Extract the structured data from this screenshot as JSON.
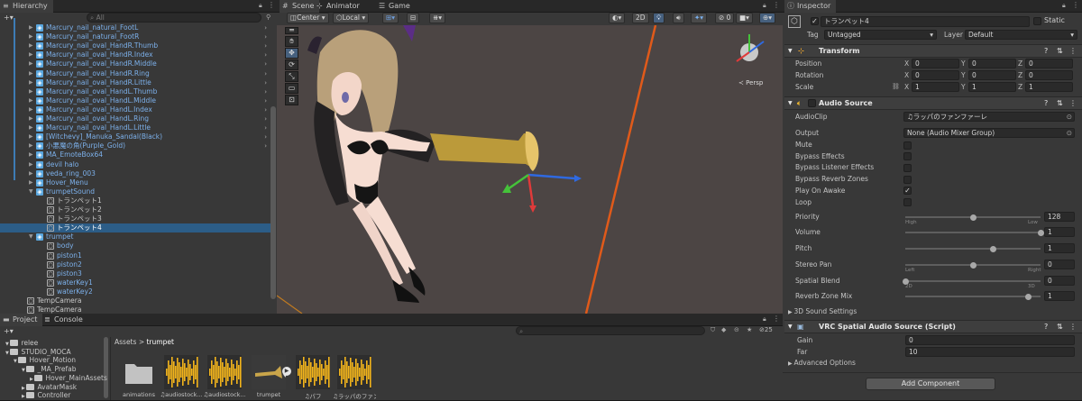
{
  "hierarchy": {
    "tab": "Hierarchy",
    "search_placeholder": "All",
    "rows": [
      {
        "label": "Marcury_nail_natural_FootL",
        "indent": 1
      },
      {
        "label": "Marcury_nail_natural_FootR",
        "indent": 1
      },
      {
        "label": "Marcury_nail_oval_HandR.Thumb",
        "indent": 1
      },
      {
        "label": "Marcury_nail_oval_HandR.Index",
        "indent": 1
      },
      {
        "label": "Marcury_nail_oval_HandR.Middle",
        "indent": 1
      },
      {
        "label": "Marcury_nail_oval_HandR.Ring",
        "indent": 1
      },
      {
        "label": "Marcury_nail_oval_HandR.Little",
        "indent": 1
      },
      {
        "label": "Marcury_nail_oval_HandL.Thumb",
        "indent": 1
      },
      {
        "label": "Marcury_nail_oval_HandL.Middle",
        "indent": 1
      },
      {
        "label": "Marcury_nail_oval_HandL.Index",
        "indent": 1
      },
      {
        "label": "Marcury_nail_oval_HandL.Ring",
        "indent": 1
      },
      {
        "label": "Marcury_nail_oval_HandL.Little",
        "indent": 1
      },
      {
        "label": "[Witchevy]_Manuka_Sandal(Black)",
        "indent": 1
      },
      {
        "label": "小悪魔の角(Purple_Gold)",
        "indent": 1
      },
      {
        "label": "MA_EmoteBox64",
        "indent": 1
      },
      {
        "label": "devil halo",
        "indent": 1
      },
      {
        "label": "veda_ring_003",
        "indent": 1
      },
      {
        "label": "Hover_Menu",
        "indent": 1
      },
      {
        "label": "trumpetSound",
        "indent": 1
      },
      {
        "label": "トランペット1",
        "indent": 2
      },
      {
        "label": "トランペット2",
        "indent": 2
      },
      {
        "label": "トランペット3",
        "indent": 2
      },
      {
        "label": "トランペット4",
        "indent": 2
      },
      {
        "label": "trumpet",
        "indent": 1
      },
      {
        "label": "body",
        "indent": 2
      },
      {
        "label": "piston1",
        "indent": 2
      },
      {
        "label": "piston2",
        "indent": 2
      },
      {
        "label": "piston3",
        "indent": 2
      },
      {
        "label": "waterKey1",
        "indent": 2
      },
      {
        "label": "waterKey2",
        "indent": 2
      },
      {
        "label": "TempCamera",
        "indent": 0
      },
      {
        "label": "TempCamera",
        "indent": 0
      }
    ]
  },
  "scene": {
    "tabs": [
      "Scene",
      "Animator",
      "Game"
    ],
    "toolbar": {
      "pivot": "Center",
      "space": "Local",
      "mode_2d": "2D"
    },
    "persp_label": "Persp"
  },
  "project": {
    "tabs": [
      "Project",
      "Console"
    ],
    "breadcrumb": [
      "Assets",
      "trumpet"
    ],
    "hidden_count": "25",
    "tree": [
      {
        "label": "relee",
        "indent": 0
      },
      {
        "label": "STUDIO_MOCA",
        "indent": 0
      },
      {
        "label": "Hover_Motion",
        "indent": 1
      },
      {
        "label": "_MA_Prefab",
        "indent": 2
      },
      {
        "label": "Hover_MainAssets",
        "indent": 3
      },
      {
        "label": "AvatarMask",
        "indent": 2
      },
      {
        "label": "Controller",
        "indent": 2
      }
    ],
    "assets": [
      {
        "label": "animations",
        "kind": "folder"
      },
      {
        "label": "♫audiostock...",
        "kind": "audio"
      },
      {
        "label": "♫audiostock...",
        "kind": "audio"
      },
      {
        "label": "trumpet",
        "kind": "model"
      },
      {
        "label": "♫パフ",
        "kind": "audio"
      },
      {
        "label": "♫ラッパのファン...",
        "kind": "audio"
      }
    ]
  },
  "inspector": {
    "tab": "Inspector",
    "object_name": "トランペット4",
    "static_label": "Static",
    "tag_label": "Tag",
    "tag_value": "Untagged",
    "layer_label": "Layer",
    "layer_value": "Default",
    "transform": {
      "title": "Transform",
      "rows": [
        {
          "label": "Position",
          "x": "0",
          "y": "0",
          "z": "0"
        },
        {
          "label": "Rotation",
          "x": "0",
          "y": "0",
          "z": "0"
        },
        {
          "label": "Scale",
          "x": "1",
          "y": "1",
          "z": "1"
        }
      ]
    },
    "audio_source": {
      "title": "Audio Source",
      "audio_clip_label": "AudioClip",
      "audio_clip_value": "♫ラッパのファンファーレ",
      "output_label": "Output",
      "output_value": "None (Audio Mixer Group)",
      "toggles": [
        {
          "label": "Mute",
          "checked": false
        },
        {
          "label": "Bypass Effects",
          "checked": false
        },
        {
          "label": "Bypass Listener Effects",
          "checked": false
        },
        {
          "label": "Bypass Reverb Zones",
          "checked": false
        },
        {
          "label": "Play On Awake",
          "checked": true
        },
        {
          "label": "Loop",
          "checked": false
        }
      ],
      "sliders": [
        {
          "label": "Priority",
          "value": "128",
          "fraction": 0.5,
          "min_label": "High",
          "max_label": "Low"
        },
        {
          "label": "Volume",
          "value": "1",
          "fraction": 1.0
        },
        {
          "label": "Pitch",
          "value": "1",
          "fraction": 0.65
        },
        {
          "label": "Stereo Pan",
          "value": "0",
          "fraction": 0.5,
          "min_label": "Left",
          "max_label": "Right"
        },
        {
          "label": "Spatial Blend",
          "value": "0",
          "fraction": 0.0,
          "min_label": "2D",
          "max_label": "3D"
        },
        {
          "label": "Reverb Zone Mix",
          "value": "1",
          "fraction": 0.91
        }
      ],
      "sound_settings": "3D Sound Settings"
    },
    "vrc": {
      "title": "VRC Spatial Audio Source (Script)",
      "gain_label": "Gain",
      "gain_value": "0",
      "far_label": "Far",
      "far_value": "10",
      "advanced": "Advanced Options"
    },
    "add_component": "Add Component"
  },
  "colors": {
    "accent": "#2c5d87",
    "link_blue": "#7cb0ea",
    "scene_bg": "#4b4443"
  }
}
